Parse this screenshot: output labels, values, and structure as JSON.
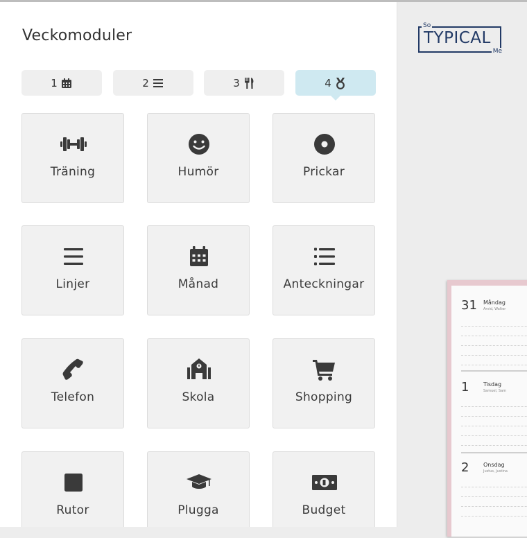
{
  "panel": {
    "title": "Veckomoduler"
  },
  "tabs": [
    {
      "number": "1",
      "icon": "calendar-icon",
      "active": false
    },
    {
      "number": "2",
      "icon": "lines-icon",
      "active": false
    },
    {
      "number": "3",
      "icon": "fork-knife-icon",
      "active": false
    },
    {
      "number": "4",
      "icon": "medal-icon",
      "active": true
    }
  ],
  "modules": [
    {
      "label": "Träning",
      "icon": "dumbbell-icon"
    },
    {
      "label": "Humör",
      "icon": "smiley-icon"
    },
    {
      "label": "Prickar",
      "icon": "dot-circle-icon"
    },
    {
      "label": "Linjer",
      "icon": "lines-icon"
    },
    {
      "label": "Månad",
      "icon": "calendar-icon"
    },
    {
      "label": "Anteckningar",
      "icon": "list-icon"
    },
    {
      "label": "Telefon",
      "icon": "phone-icon"
    },
    {
      "label": "Skola",
      "icon": "school-icon"
    },
    {
      "label": "Shopping",
      "icon": "cart-icon"
    },
    {
      "label": "Rutor",
      "icon": "square-icon"
    },
    {
      "label": "Plugga",
      "icon": "graduation-cap-icon"
    },
    {
      "label": "Budget",
      "icon": "money-icon"
    }
  ],
  "logo": {
    "top": "So",
    "main": "TYPICAL",
    "bottom": "Me"
  },
  "preview": {
    "days": [
      {
        "num": "31",
        "name": "Måndag",
        "names": "Arvid, Walter"
      },
      {
        "num": "1",
        "name": "Tisdag",
        "names": "Samuel, Sam"
      },
      {
        "num": "2",
        "name": "Onsdag",
        "names": "Justus, Justina"
      }
    ]
  },
  "colors": {
    "accent_tab": "#cfe9f1",
    "icon": "#3a3a3a",
    "card_bg": "#f1f1f1",
    "logo": "#223a66",
    "planner_cover": "#e7c9cf"
  }
}
